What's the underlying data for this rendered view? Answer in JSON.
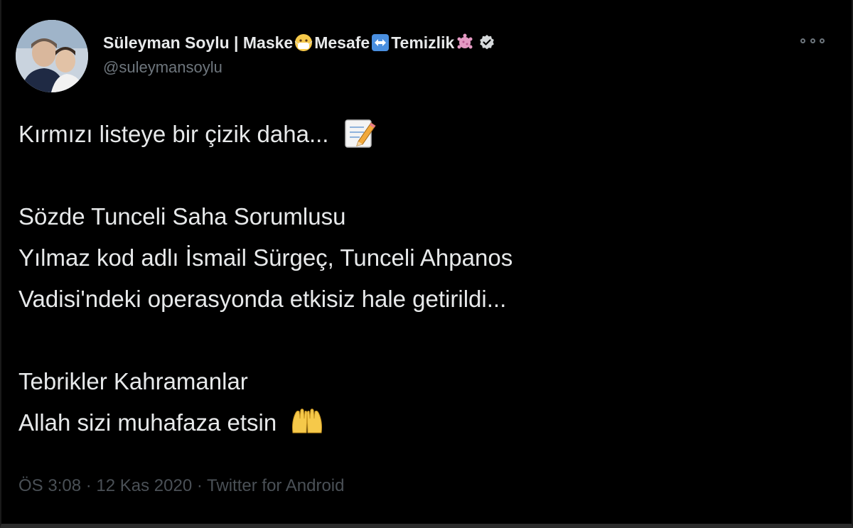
{
  "author": {
    "name_part1": "Süleyman Soylu | Maske",
    "name_part2": "Mesafe",
    "name_part3": "Temizlik",
    "handle": "@suleymansoylu",
    "avatar_icon": "profile-photo",
    "verified_icon": "verified-badge-icon"
  },
  "tweet": {
    "line1": "Kırmızı listeye bir çizik daha...",
    "line2": "Sözde Tunceli Saha Sorumlusu",
    "line3": "Yılmaz kod adlı İsmail Sürgeç, Tunceli Ahpanos",
    "line4": "Vadisi'ndeki operasyonda etkisiz hale getirildi...",
    "line5": "Tebrikler Kahramanlar",
    "line6": "Allah sizi muhafaza etsin"
  },
  "meta": {
    "text": "ÖS 3:08 · 12 Kas 2020 · Twitter for Android"
  },
  "colors": {
    "background": "#000000",
    "text": "#e7e9ea",
    "secondary": "#6e767d"
  },
  "icons": {
    "mask": "face-with-medical-mask-icon",
    "distance": "left-right-arrow-icon",
    "clean": "microbe-icon",
    "memo": "memo-icon",
    "hands": "raising-hands-icon",
    "more": "more-options-icon"
  }
}
